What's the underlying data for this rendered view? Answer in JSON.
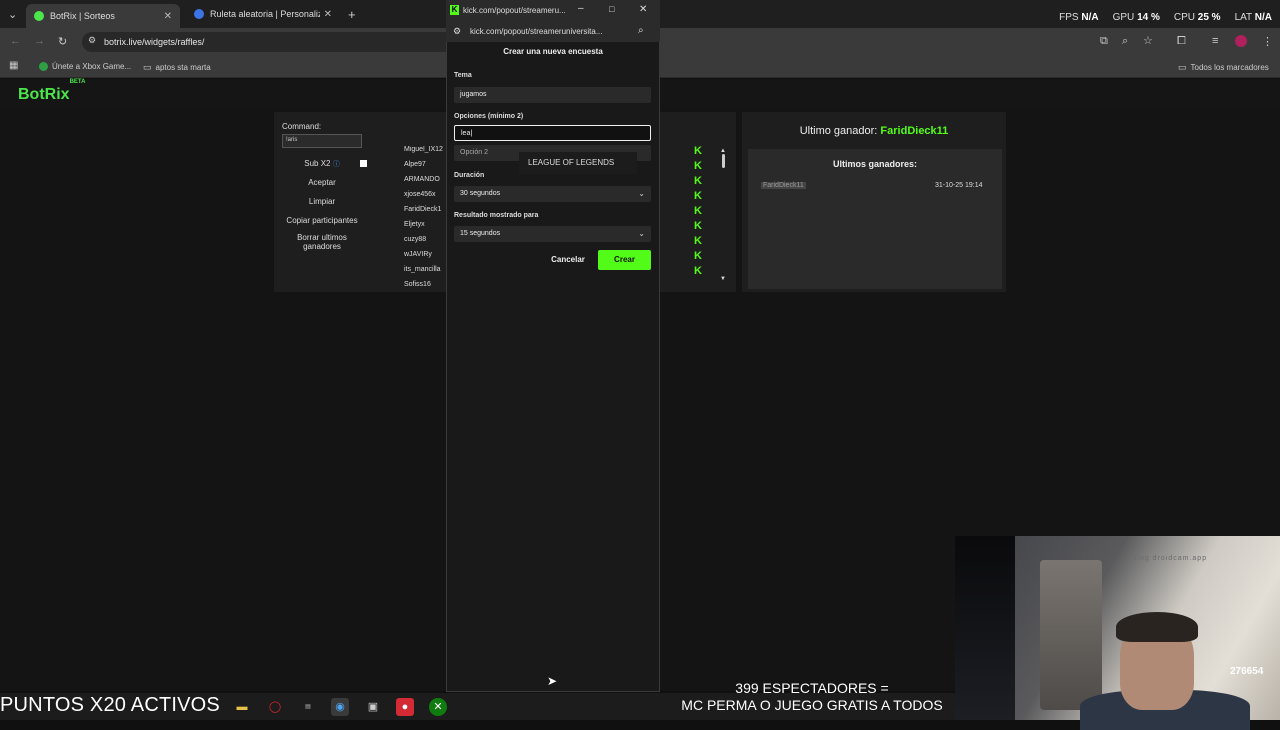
{
  "browser": {
    "tabs": [
      {
        "title": "BotRix | Sorteos",
        "active": true
      },
      {
        "title": "Ruleta aleatoria | Personaliza y",
        "active": false
      }
    ],
    "url": "botrix.live/widgets/raffles/",
    "bookmarks": [
      "Únete a Xbox Game...",
      "aptos sta marta"
    ],
    "all_bookmarks_label": "Todos los marcadores"
  },
  "perf_overlay": {
    "fps_label": "FPS",
    "fps_value": "N/A",
    "gpu_label": "GPU",
    "gpu_value": "14 %",
    "cpu_label": "CPU",
    "cpu_value": "25 %",
    "lat_label": "LAT",
    "lat_value": "N/A"
  },
  "page": {
    "brand": "BotRix",
    "brand_badge": "BETA",
    "command_label": "Command:",
    "command_value": "!aris",
    "sub_label": "Sub X2",
    "buttons": [
      "Aceptar",
      "Limpiar",
      "Copiar participantes",
      "Borrar ultimos ganadores"
    ],
    "participants": [
      "Miguel_IX12",
      "Alpe97",
      "ARMANDO",
      "xjose456x",
      "FaridDieck1",
      "Eljetyx",
      "cuzy88",
      "wJAVIRy",
      "its_mancilla",
      "Sofiss16"
    ],
    "winner_title_prefix": "Ultimo ganador:",
    "winner_name": "FaridDieck11",
    "last_winners_label": "Ultimos ganadores:",
    "last_winner_entry": "FaridDieck11",
    "last_winner_date": "31-10-25 19:14"
  },
  "popup": {
    "window_title": "kick.com/popout/streameru...",
    "url": "kick.com/popout/streameruniversita...",
    "heading": "Crear una nueva encuesta",
    "topic_label": "Tema",
    "topic_value": "jugamos",
    "options_label": "Opciones (mínimo 2)",
    "option1_value": "lea",
    "option2_placeholder": "Opción 2",
    "suggestion": "LEAGUE OF LEGENDS",
    "duration_label": "Duración",
    "duration_value": "30 segundos",
    "result_label": "Resultado mostrado para",
    "result_value": "15 segundos",
    "cancel_label": "Cancelar",
    "create_label": "Crear"
  },
  "overlay": {
    "puntos": "PUNTOS X20 ACTIVOS",
    "ticker_line1": "399 ESPECTADORES =",
    "ticker_line2": "MC PERMA O JUEGO GRATIS A TODOS",
    "cam_watermark": "using droidcam.app",
    "cam_counter": "276654"
  },
  "colors": {
    "accent": "#53fc18",
    "brand": "#4ce64c"
  }
}
